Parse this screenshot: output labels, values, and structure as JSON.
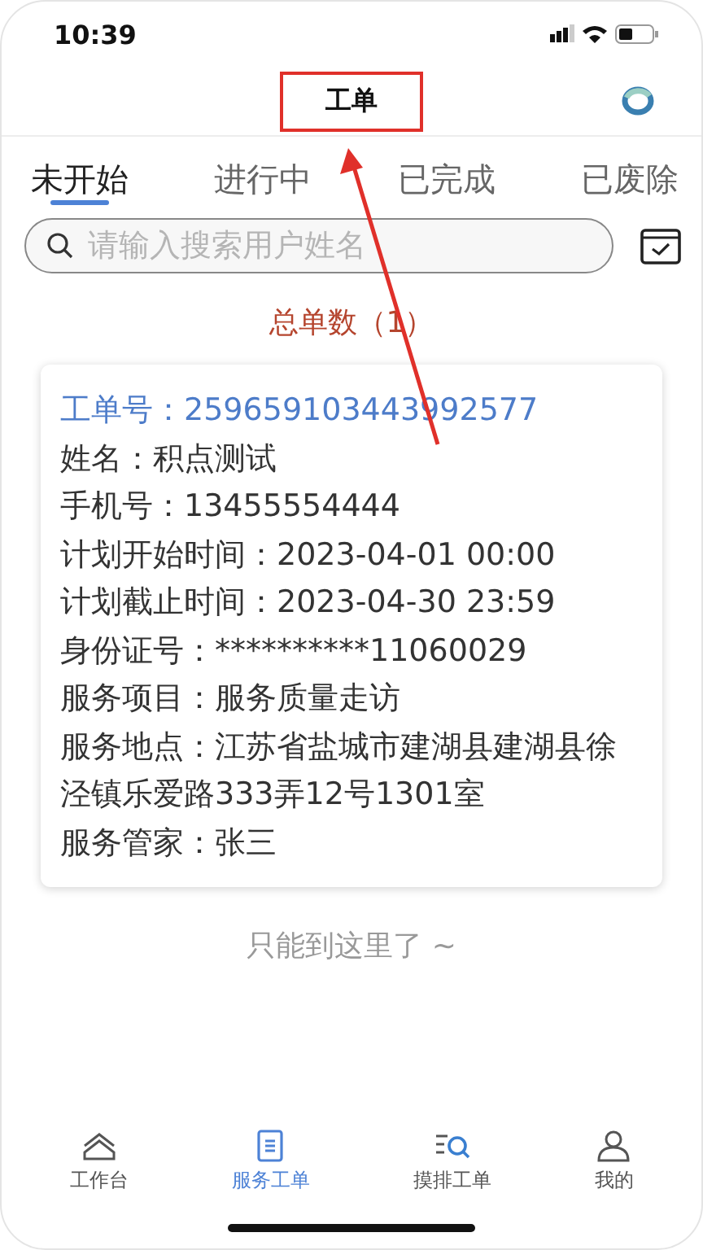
{
  "status_bar": {
    "time": "10:39"
  },
  "header": {
    "title": "工单",
    "annotated": true
  },
  "tabs": [
    {
      "label": "未开始",
      "selected": true
    },
    {
      "label": "进行中",
      "selected": false
    },
    {
      "label": "已完成",
      "selected": false
    },
    {
      "label": "已废除",
      "selected": false
    }
  ],
  "search": {
    "placeholder": "请输入搜索用户姓名"
  },
  "total": "总单数（1）",
  "orders": [
    {
      "fields": [
        {
          "kind": "id",
          "label": "工单号：",
          "value": "259659103443992577"
        },
        {
          "kind": "plain",
          "label": "姓名：",
          "value": "积点测试"
        },
        {
          "kind": "plain",
          "label": "手机号：",
          "value": "13455554444"
        },
        {
          "kind": "plain",
          "label": "计划开始时间：",
          "value": "2023-04-01 00:00"
        },
        {
          "kind": "plain",
          "label": "计划截止时间：",
          "value": "2023-04-30 23:59"
        },
        {
          "kind": "plain",
          "label": "身份证号：",
          "value": "**********11060029"
        },
        {
          "kind": "plain",
          "label": "服务项目：",
          "value": "服务质量走访"
        },
        {
          "kind": "plain",
          "label": "服务地点：",
          "value": "江苏省盐城市建湖县建湖县徐泾镇乐爱路333弄12号1301室"
        },
        {
          "kind": "plain",
          "label": "服务管家：",
          "value": "张三"
        }
      ]
    }
  ],
  "end_text": "只能到这里了 ~",
  "nav": [
    {
      "label": "工作台",
      "kind": "home",
      "selected": false
    },
    {
      "label": "服务工单",
      "kind": "doc",
      "selected": true
    },
    {
      "label": "摸排工单",
      "kind": "listsearch",
      "selected": false
    },
    {
      "label": "我的",
      "kind": "user",
      "selected": false
    }
  ]
}
